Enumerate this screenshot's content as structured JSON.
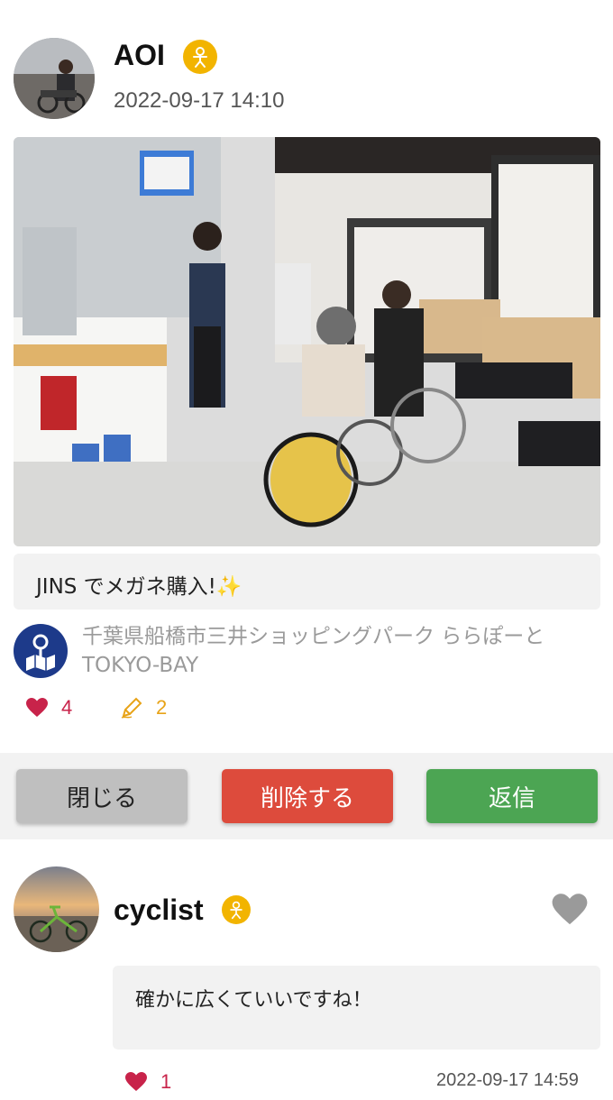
{
  "post": {
    "username": "AOI",
    "timestamp": "2022-09-17 14:10",
    "caption": "JINS でメガネ購入!✨",
    "location": "千葉県船橋市三井ショッピングパーク ららぽーと TOKYO-BAY",
    "likes": "4",
    "comments": "2"
  },
  "actions": {
    "close_label": "閉じる",
    "delete_label": "削除する",
    "reply_label": "返信"
  },
  "reply": {
    "username": "cyclist",
    "text": "確かに広くていいですね！",
    "likes": "1",
    "timestamp": "2022-09-17 14:59"
  },
  "colors": {
    "heart": "#c8234a",
    "pencil": "#e8a317",
    "badge": "#f2b400",
    "close_bg": "#bfbfbf",
    "delete_bg": "#dd4b3c",
    "reply_bg": "#4ca553",
    "location_icon_bg": "#1d3a8a"
  },
  "icons": {
    "user_badge": "person-badge-icon",
    "location": "map-pin-icon",
    "like": "heart-icon",
    "comment": "pencil-icon",
    "reply_like": "heart-outline-gray-icon"
  }
}
